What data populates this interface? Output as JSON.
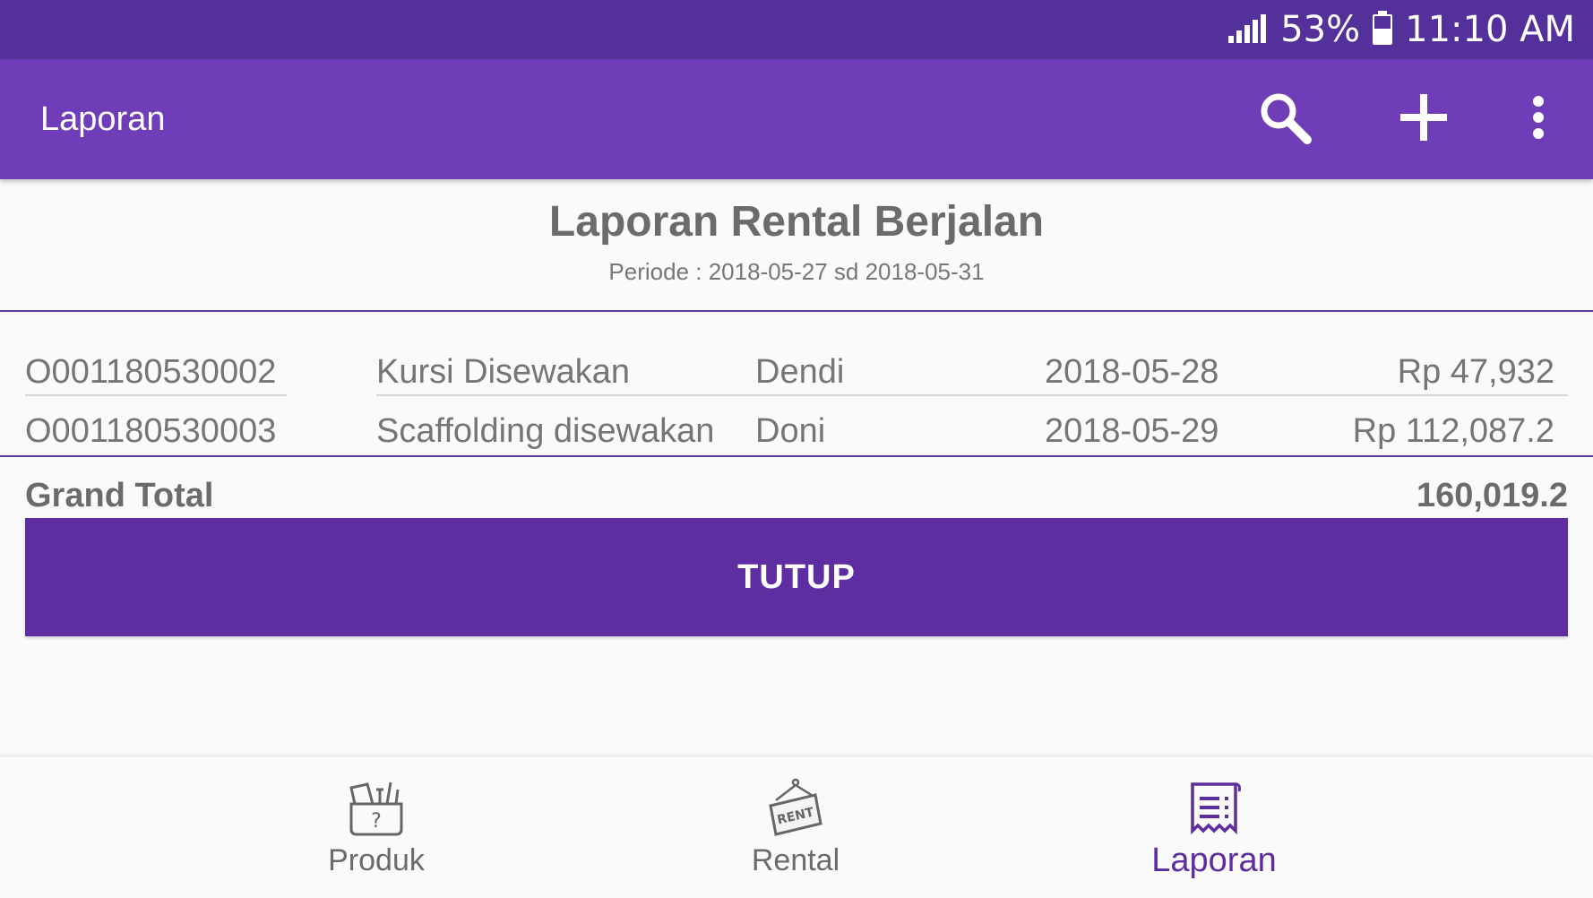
{
  "status_bar": {
    "battery": "53%",
    "time": "11:10 AM"
  },
  "app_bar": {
    "title": "Laporan",
    "icons": [
      "search-icon",
      "add-icon",
      "more-vert-icon"
    ]
  },
  "report": {
    "title": "Laporan Rental Berjalan",
    "period": "Periode : 2018-05-27 sd 2018-05-31",
    "rows": [
      {
        "code": "O001180530002",
        "item": "Kursi Disewakan",
        "customer": "Dendi",
        "date": "2018-05-28",
        "amount": "Rp 47,932"
      },
      {
        "code": "O001180530003",
        "item": "Scaffolding disewakan",
        "customer": "Doni",
        "date": "2018-05-29",
        "amount": "Rp 112,087.2"
      }
    ],
    "grand_total_label": "Grand Total",
    "grand_total_value": "160,019.2"
  },
  "close_button": "TUTUP",
  "bottom_nav": {
    "items": [
      {
        "label": "Produk",
        "icon": "product-box-icon",
        "active": false
      },
      {
        "label": "Rental",
        "icon": "rent-sign-icon",
        "active": false
      },
      {
        "label": "Laporan",
        "icon": "report-receipt-icon",
        "active": true
      }
    ]
  },
  "colors": {
    "status_bar": "#54319a",
    "app_bar": "#6f3db7",
    "accent": "#5e2d9f"
  }
}
